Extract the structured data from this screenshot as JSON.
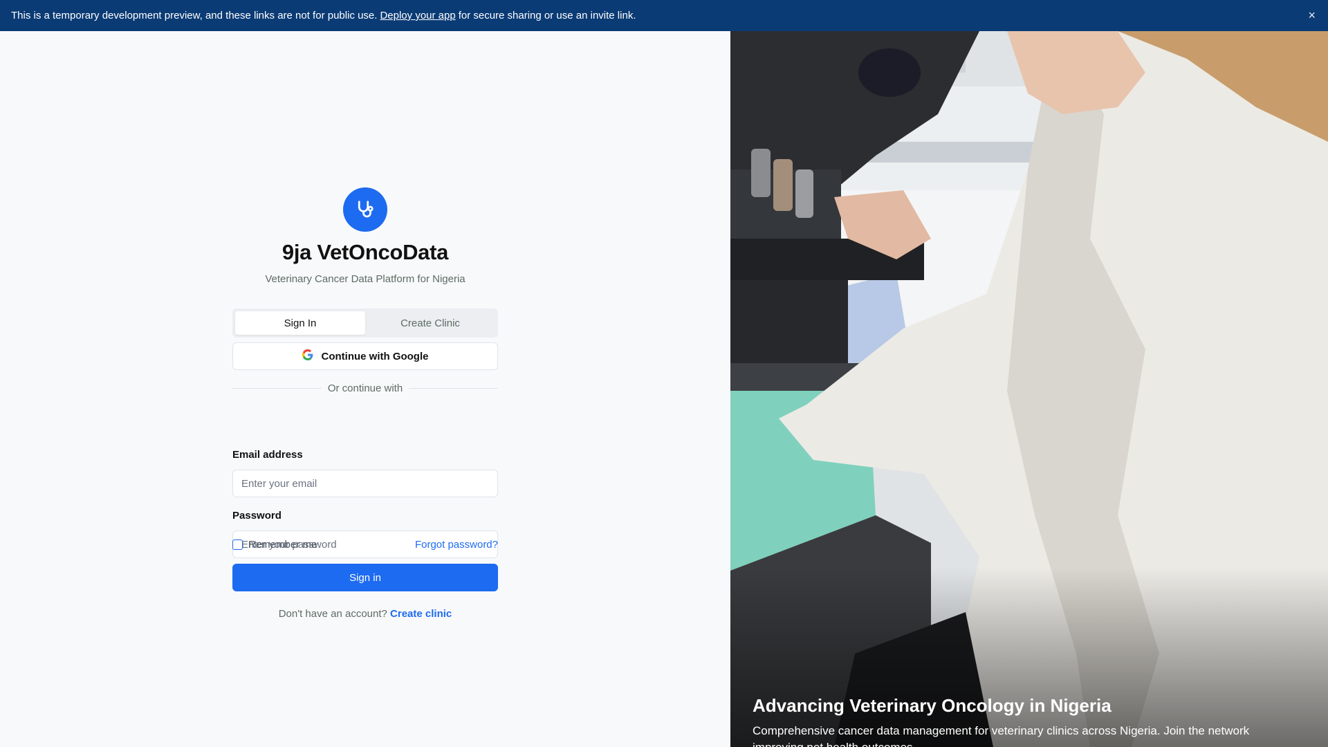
{
  "banner": {
    "text_before": "This is a temporary development preview, and these links are not for public use.",
    "link_text": "Deploy your app",
    "text_after": "for secure sharing or use an invite link.",
    "close_symbol": "×"
  },
  "brand": {
    "name": "9ja VetOncoData",
    "tagline": "Veterinary Cancer Data Platform for Nigeria",
    "logo_icon": "stethoscope-icon",
    "accent_color": "#1d6bf0"
  },
  "tabs": [
    {
      "label": "Sign In",
      "active": true
    },
    {
      "label": "Create Clinic",
      "active": false
    }
  ],
  "google_button": {
    "label": "Continue with Google",
    "icon": "google-icon"
  },
  "divider_text": "Or continue with",
  "email": {
    "label": "Email address",
    "placeholder": "Enter your email",
    "value": ""
  },
  "password": {
    "label": "Password",
    "placeholder": "Enter your password",
    "value": ""
  },
  "remember_me": {
    "label": "Remember me",
    "checked": false
  },
  "forgot_password": "Forgot password?",
  "signin_button": "Sign in",
  "account_prompt": {
    "text": "Don't have an account?",
    "link": "Create clinic"
  },
  "hero": {
    "title": "Advancing Veterinary Oncology in Nigeria",
    "text": "Comprehensive cancer data management for veterinary clinics across Nigeria. Join the network improving pet health outcomes."
  }
}
